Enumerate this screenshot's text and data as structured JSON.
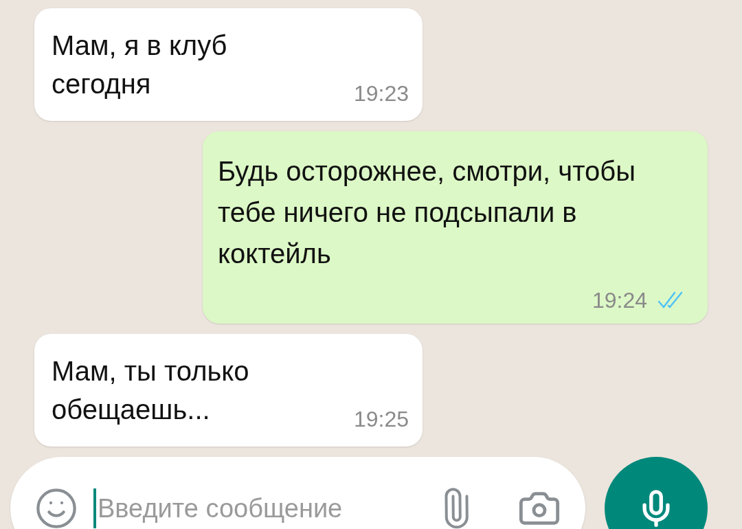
{
  "messages": [
    {
      "kind": "incoming",
      "text": "Мам, я в клуб сегодня",
      "time": "19:23"
    },
    {
      "kind": "outgoing",
      "text": "Будь осторожнее, смотри, чтобы тебе ничего не подсыпали в коктейль",
      "time": "19:24",
      "read": true
    },
    {
      "kind": "incoming",
      "text": "Мам, ты только обещаешь...",
      "time": "19:25"
    }
  ],
  "composer": {
    "placeholder": "Введите сообщение"
  }
}
